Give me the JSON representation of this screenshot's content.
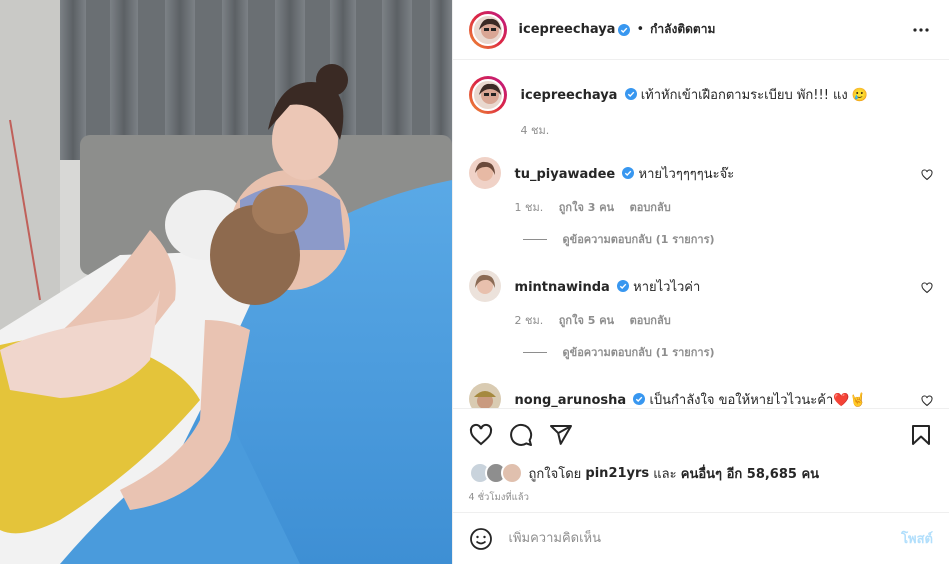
{
  "post_header": {
    "username": "icepreechaya",
    "separator": "•",
    "follow_status": "กำลังติดตาม"
  },
  "caption": {
    "username": "icepreechaya",
    "text": "เท้าหักเข้าเฝือกตามระเบียบ พัก!!! แง 🥲",
    "time": "4 ชม."
  },
  "comments": [
    {
      "username": "tu_piyawadee",
      "text": "หายไวๆๆๆๆนะจ๊ะ",
      "time": "1 ชม.",
      "likes": "ถูกใจ 3 คน",
      "reply_label": "ตอบกลับ",
      "view_replies": "ดูข้อความตอบกลับ (1 รายการ)"
    },
    {
      "username": "mintnawinda",
      "text": "หายไวไวค่า",
      "time": "2 ชม.",
      "likes": "ถูกใจ 5 คน",
      "reply_label": "ตอบกลับ",
      "view_replies": "ดูข้อความตอบกลับ (1 รายการ)"
    },
    {
      "username": "nong_arunosha",
      "text": "เป็นกำลังใจ ขอให้หายไวไวนะค้า❤️🤘"
    }
  ],
  "likes": {
    "prefix": "ถูกใจโดย",
    "user": "pin21yrs",
    "and": "และ",
    "others": "คนอื่นๆ",
    "count_label": "อีก 58,685 คน"
  },
  "timestamp": "4 ชั่วโมงที่แล้ว",
  "add_comment": {
    "placeholder": "เพิ่มความคิดเห็น",
    "post_label": "โพสต์"
  },
  "icons": [
    "more-icon",
    "verified-icon",
    "heart-icon",
    "comment-icon",
    "share-icon",
    "bookmark-icon",
    "emoji-icon"
  ],
  "colors": {
    "verified": "#3897f0",
    "post_button": "#b2dffc",
    "muted": "#8e8e8e"
  }
}
